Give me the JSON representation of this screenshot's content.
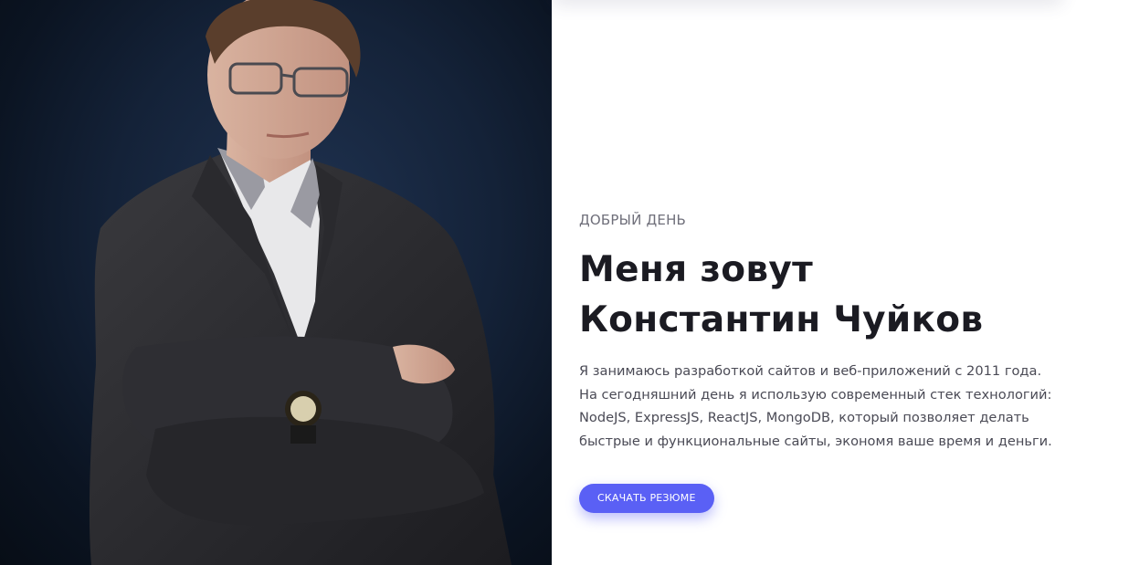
{
  "hero": {
    "greeting": "ДОБРЫЙ ДЕНЬ",
    "title_line1": "Меня зовут",
    "title_line2": "Константин Чуйков",
    "description_lines": [
      "Я занимаюсь разработкой сайтов и веб-приложений с 2011 года.",
      "На сегодняшний день я использую современный стек технологий:",
      "NodeJS, ExpressJS, ReactJS, MongoDB, который позволяет делать",
      "быстрые и функциональные сайты, экономя ваше время и деньги."
    ],
    "download_button": "СКАЧАТЬ РЕЗЮМЕ",
    "photo_icon": "portrait-photo"
  },
  "colors": {
    "accent": "#5a60f5",
    "title": "#1b1b22",
    "text": "#4a4a55",
    "photo_background": "#142238"
  }
}
